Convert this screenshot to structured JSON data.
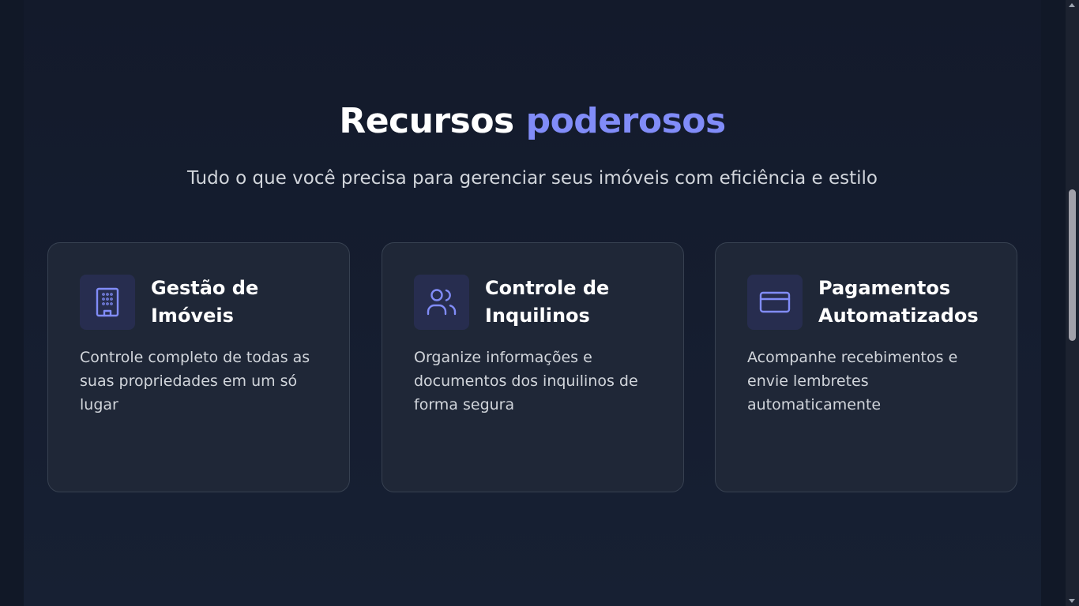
{
  "section": {
    "title_main": "Recursos",
    "title_accent": "poderosos",
    "subtitle": "Tudo o que você precisa para gerenciar seus imóveis com eficiência e estilo"
  },
  "features": [
    {
      "icon": "building-icon",
      "title": "Gestão de Imóveis",
      "description": "Controle completo de todas as suas propriedades em um só lugar"
    },
    {
      "icon": "users-icon",
      "title": "Controle de Inquilinos",
      "description": "Organize informações e documentos dos inquilinos de forma segura"
    },
    {
      "icon": "credit-card-icon",
      "title": "Pagamentos Automatizados",
      "description": "Acompanhe recebimentos e envie lembretes automaticamente"
    }
  ],
  "colors": {
    "accent": "#818cf8",
    "background": "#111827",
    "card": "#1f2737",
    "icon_bg": "#272d4f"
  }
}
